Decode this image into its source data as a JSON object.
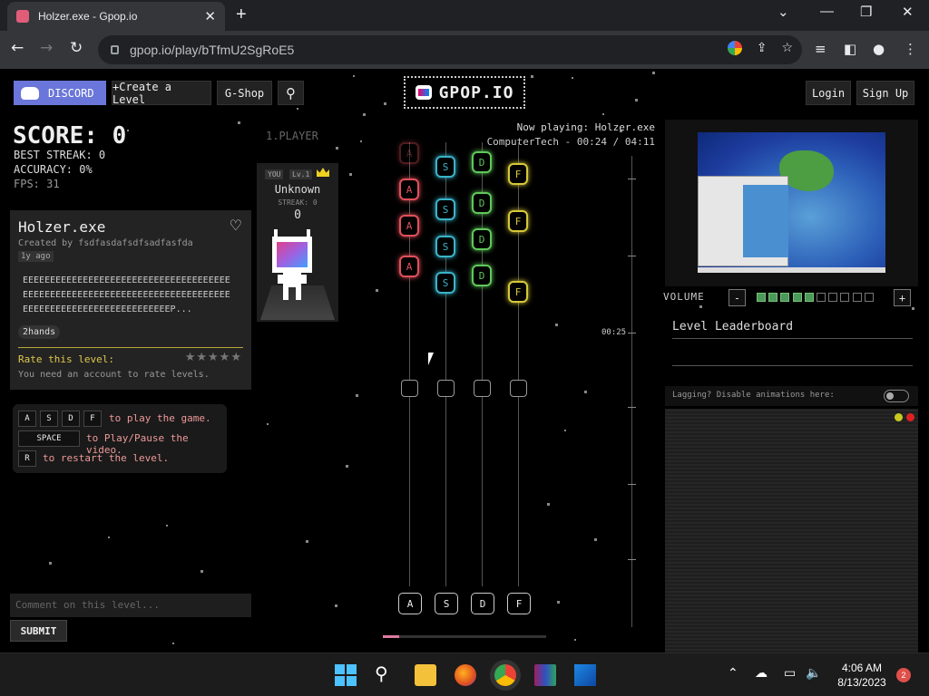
{
  "browser": {
    "tab_title": "Holzer.exe - Gpop.io",
    "url": "gpop.io/play/bTfmU2SgRoE5"
  },
  "nav": {
    "discord": "DISCORD",
    "create_level": "+Create a Level",
    "gshop": "G-Shop",
    "login": "Login",
    "signup": "Sign Up",
    "logo_text": "GPOP.IO"
  },
  "stats": {
    "score": "SCORE: 0",
    "best_streak": "BEST STREAK: 0",
    "accuracy": "ACCURACY: 0%",
    "fps": "FPS: 31"
  },
  "level": {
    "title": "Holzer.exe",
    "created_by": "Created by fsdfasdafsdfsadfasfda",
    "ago": "1y ago",
    "description": "EEEEEEEEEEEEEEEEEEEEEEEEEEEEEEEEEEEEEEEEEEEEEEEEEEEEEEEEEEEEEEEEEEEEEEEEEEEEEEEEEEEEEEEEEEEEEEEEEEEEEEEP...",
    "tag": "2hands",
    "rate_label": "Rate this level:",
    "need_account": "You need an account to rate levels."
  },
  "controls": {
    "keys": [
      "A",
      "S",
      "D",
      "F"
    ],
    "play_text": "to play the game.",
    "space_key": "SPACE",
    "pause_text": "to Play/Pause the video.",
    "restart_key": "R",
    "restart_text": "to restart the level."
  },
  "comment": {
    "placeholder": "Comment on this level...",
    "submit": "SUBMIT"
  },
  "player": {
    "label": "1.PLAYER",
    "you_badge": "YOU",
    "level_badge": "Lv.1",
    "name": "Unknown",
    "streak": "STREAK: 0",
    "score": "0"
  },
  "now_playing": {
    "line1": "Now playing: Holzer.exe",
    "line2": "ComputerTech - 00:24 / 04:11"
  },
  "track": {
    "timestamp": "00:25",
    "lane_keys": [
      "A",
      "S",
      "D",
      "F"
    ],
    "lane_colors": [
      "#e0505a",
      "#3ab3c8",
      "#5fc85a",
      "#d6c83a"
    ],
    "progress_fraction": 0.1
  },
  "volume": {
    "label": "VOLUME",
    "minus": "-",
    "plus": "+",
    "level": 5,
    "max": 10
  },
  "leaderboard": {
    "title": "Level Leaderboard"
  },
  "lag": {
    "text": "Lagging? Disable animations here:"
  },
  "taskbar": {
    "time": "4:06 AM",
    "date": "8/13/2023",
    "notifications": "2"
  }
}
